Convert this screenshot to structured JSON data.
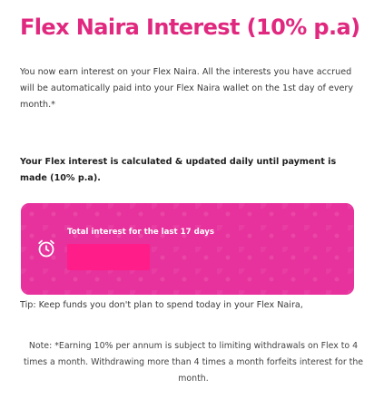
{
  "page": {
    "title": "Flex Naira Interest (10% p.a)",
    "intro": "You now earn interest on your Flex Naira. All the interests you have accrued will be automatically paid into your Flex Naira wallet on the 1st day of every month.*",
    "calculation_note": "Your Flex interest is calculated & updated daily until payment is made (10% p.a)."
  },
  "interest_card": {
    "label": "Total interest for the last 17 days",
    "icon": "alarm-clock-icon",
    "amount": ""
  },
  "tip": "Tip: Keep funds you don't plan to spend today in your Flex Naira,",
  "note": "Note: *Earning 10% per annum is subject to limiting withdrawals on Flex to 4 times a month. Withdrawing more than 4 times a month forfeits interest for the month.",
  "colors": {
    "brand": "#e0287f",
    "card_background": "#e7319c",
    "amount_mask": "#ff1d8a"
  }
}
